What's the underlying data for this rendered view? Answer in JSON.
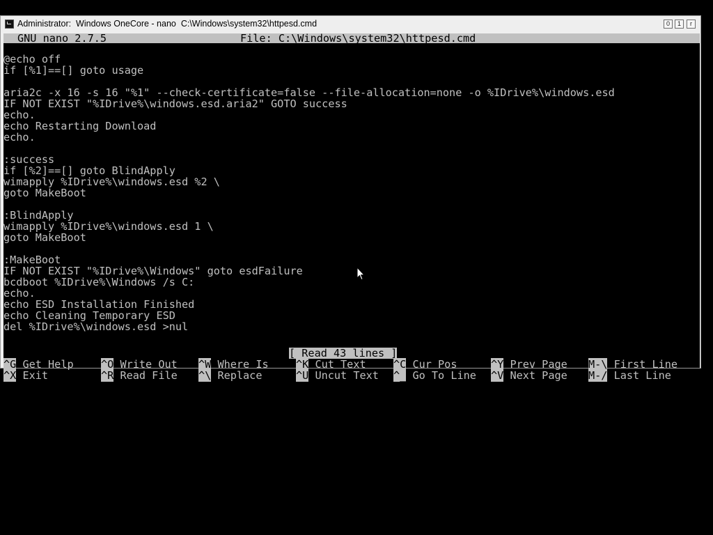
{
  "window": {
    "title": "Administrator:  Windows OneCore - nano  C:\\Windows\\system32\\httpesd.cmd",
    "buttons": {
      "minimize": "0",
      "maximize": "1",
      "restore": "r"
    }
  },
  "nano": {
    "version": "GNU nano 2.7.5",
    "file": "File: C:\\Windows\\system32\\httpesd.cmd",
    "lines": [
      "@echo off",
      "if [%1]==[] goto usage",
      "",
      "aria2c -x 16 -s 16 \"%1\" --check-certificate=false --file-allocation=none -o %IDrive%\\windows.esd",
      "IF NOT EXIST \"%IDrive%\\windows.esd.aria2\" GOTO success",
      "echo.",
      "echo Restarting Download",
      "echo.",
      "",
      ":success",
      "if [%2]==[] goto BlindApply",
      "wimapply %IDrive%\\windows.esd %2 \\",
      "goto MakeBoot",
      "",
      ":BlindApply",
      "wimapply %IDrive%\\windows.esd 1 \\",
      "goto MakeBoot",
      "",
      ":MakeBoot",
      "IF NOT EXIST \"%IDrive%\\Windows\" goto esdFailure",
      "bcdboot %IDrive%\\Windows /s C:",
      "echo.",
      "echo ESD Installation Finished",
      "echo Cleaning Temporary ESD",
      "del %IDrive%\\windows.esd >nul"
    ],
    "status": "[ Read 43 lines ]",
    "shortcuts": [
      {
        "key": "^G",
        "label": "Get Help"
      },
      {
        "key": "^O",
        "label": "Write Out"
      },
      {
        "key": "^W",
        "label": "Where Is"
      },
      {
        "key": "^K",
        "label": "Cut Text"
      },
      {
        "key": "^C",
        "label": "Cur Pos"
      },
      {
        "key": "^Y",
        "label": "Prev Page"
      },
      {
        "key": "M-\\",
        "label": "First Line"
      },
      {
        "key": "^X",
        "label": "Exit"
      },
      {
        "key": "^R",
        "label": "Read File"
      },
      {
        "key": "^\\",
        "label": "Replace"
      },
      {
        "key": "^U",
        "label": "Uncut Text"
      },
      {
        "key": "^_",
        "label": "Go To Line"
      },
      {
        "key": "^V",
        "label": "Next Page"
      },
      {
        "key": "M-/",
        "label": "Last Line"
      }
    ]
  },
  "icons": {
    "window_icon": "console-icon",
    "pointer": "mouse-pointer-icon"
  },
  "colors": {
    "terminal_bg": "#000000",
    "terminal_fg": "#c0c0c0",
    "inverse_bg": "#c0c0c0"
  }
}
